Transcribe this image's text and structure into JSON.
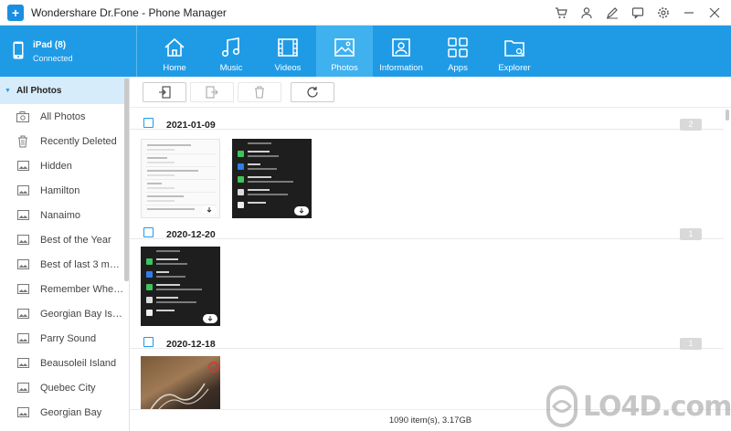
{
  "window": {
    "title": "Wondershare Dr.Fone - Phone Manager",
    "controls": [
      "cart-icon",
      "user-icon",
      "edit-icon",
      "feedback-icon",
      "settings-icon",
      "minimize-icon",
      "close-icon"
    ]
  },
  "device": {
    "name": "iPad (8)",
    "status": "Connected"
  },
  "nav": {
    "tabs": [
      {
        "label": "Home",
        "icon": "home-icon",
        "active": false
      },
      {
        "label": "Music",
        "icon": "music-icon",
        "active": false
      },
      {
        "label": "Videos",
        "icon": "video-icon",
        "active": false
      },
      {
        "label": "Photos",
        "icon": "photo-icon",
        "active": true
      },
      {
        "label": "Information",
        "icon": "contact-icon",
        "active": false
      },
      {
        "label": "Apps",
        "icon": "apps-icon",
        "active": false
      },
      {
        "label": "Explorer",
        "icon": "folder-icon",
        "active": false
      }
    ]
  },
  "sidebar": {
    "header": "All Photos",
    "items": [
      {
        "label": "All Photos",
        "icon": "camera-icon"
      },
      {
        "label": "Recently Deleted",
        "icon": "trash-icon"
      },
      {
        "label": "Hidden",
        "icon": "album-icon"
      },
      {
        "label": "Hamilton",
        "icon": "album-icon"
      },
      {
        "label": "Nanaimo",
        "icon": "album-icon"
      },
      {
        "label": "Best of the Year",
        "icon": "album-icon"
      },
      {
        "label": "Best of last 3 mon...",
        "icon": "album-icon"
      },
      {
        "label": "Remember When...",
        "icon": "album-icon"
      },
      {
        "label": "Georgian Bay Isla...",
        "icon": "album-icon"
      },
      {
        "label": "Parry Sound",
        "icon": "album-icon"
      },
      {
        "label": "Beausoleil Island",
        "icon": "album-icon"
      },
      {
        "label": "Quebec City",
        "icon": "album-icon"
      },
      {
        "label": "Georgian Bay",
        "icon": "album-icon"
      }
    ]
  },
  "toolbar": {
    "buttons": [
      {
        "name": "import-button",
        "icon": "import-icon",
        "enabled": true
      },
      {
        "name": "export-button",
        "icon": "export-icon",
        "enabled": false
      },
      {
        "name": "delete-button",
        "icon": "trash-icon",
        "enabled": false
      },
      {
        "name": "refresh-button",
        "icon": "refresh-icon",
        "enabled": true
      }
    ]
  },
  "groups": [
    {
      "date": "2021-01-09",
      "count": "2"
    },
    {
      "date": "2020-12-20",
      "count": "1"
    },
    {
      "date": "2020-12-18",
      "count": "1"
    }
  ],
  "thumbs": {
    "light_lines": [
      {
        "title": "Rogers modem code",
        "sub": "2020-01-05 Q1"
      },
      {
        "title": "Byron",
        "sub": "2020-01-05 Q1"
      },
      {
        "title": "Bell modem replacement",
        "sub": "2020-01-05 Q1"
      },
      {
        "title": "Vape",
        "sub": "2020-01-05 Q1"
      },
      {
        "title": "Google signin",
        "sub": "2020-01-05 Q1"
      },
      {
        "title": "Drones for Beginners",
        "sub": "2020-01-05 Q1"
      }
    ],
    "siri_rows": [
      {
        "title": "FaceTime",
        "sub": "\"FaceTime Adrian\""
      },
      {
        "title": "Apps",
        "sub": "\"Launch Photos\""
      },
      {
        "title": "Messages",
        "sub": "\"Tell Kai I'll be right there\""
      },
      {
        "title": "Apple Pay",
        "sub": "\"Apple Pay $20 to Orion\""
      },
      {
        "title": "Calendar",
        "sub": ""
      }
    ],
    "siri_top": "\"Call Carmen\""
  },
  "status": {
    "summary": "1090 item(s), 3.17GB"
  },
  "watermark": "LO4D.com",
  "colors": {
    "accent": "#1f9be6",
    "active_tab": "#3fb1ef",
    "sidebar_selected": "#d7ecfa"
  }
}
